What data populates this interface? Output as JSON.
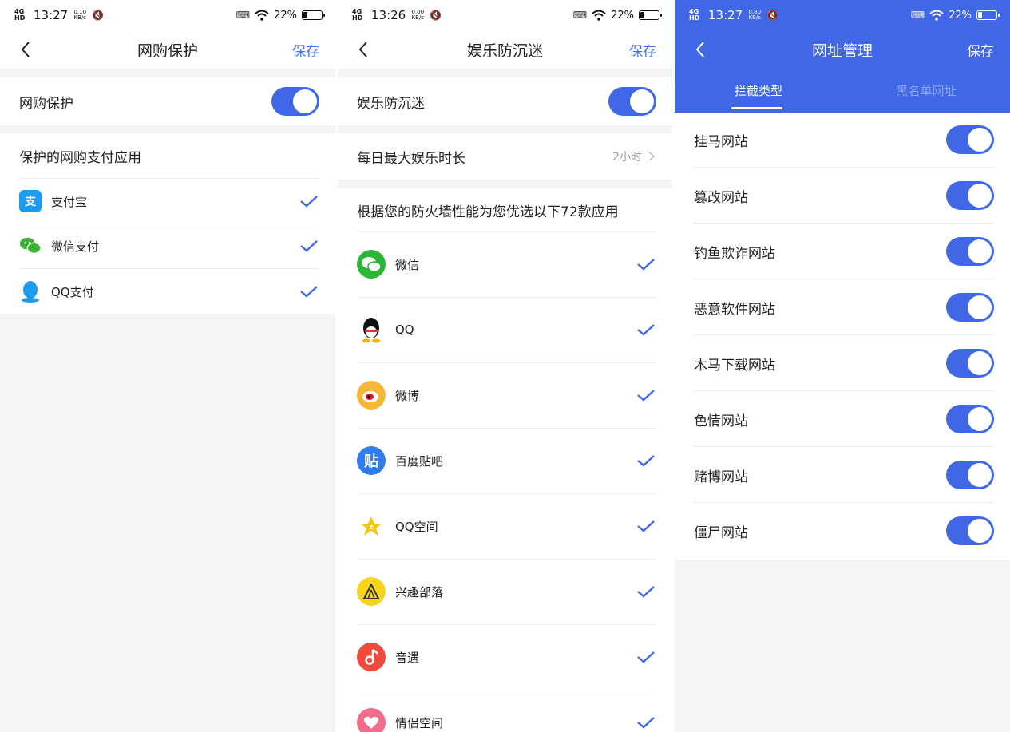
{
  "screens": [
    {
      "status": {
        "network": "4G HD",
        "time": "13:27",
        "speed": "0.10 KB/s",
        "battery": "22%",
        "battery_level": 0.22
      },
      "title": "网购保护",
      "save_label": "保存",
      "main_toggle_label": "网购保护",
      "main_toggle_on": true,
      "section_header": "保护的网购支付应用",
      "apps": [
        {
          "label": "支付宝",
          "icon": "alipay-icon",
          "checked": true
        },
        {
          "label": "微信支付",
          "icon": "wechat-pay-icon",
          "checked": true
        },
        {
          "label": "QQ支付",
          "icon": "qq-pay-icon",
          "checked": true
        }
      ]
    },
    {
      "status": {
        "network": "4G HD",
        "time": "13:26",
        "speed": "0.00 KB/s",
        "battery": "22%",
        "battery_level": 0.22
      },
      "title": "娱乐防沉迷",
      "save_label": "保存",
      "main_toggle_label": "娱乐防沉迷",
      "main_toggle_on": true,
      "daily_limit_label": "每日最大娱乐时长",
      "daily_limit_value": "2小时",
      "section_header": "根据您的防火墙性能为您优选以下72款应用",
      "apps": [
        {
          "label": "微信",
          "icon": "wechat-icon",
          "checked": true
        },
        {
          "label": "QQ",
          "icon": "qq-icon",
          "checked": true
        },
        {
          "label": "微博",
          "icon": "weibo-icon",
          "checked": true
        },
        {
          "label": "百度贴吧",
          "icon": "tieba-icon",
          "checked": true
        },
        {
          "label": "QQ空间",
          "icon": "qzone-icon",
          "checked": true
        },
        {
          "label": "兴趣部落",
          "icon": "buluo-icon",
          "checked": true
        },
        {
          "label": "音遇",
          "icon": "yinyu-icon",
          "checked": true
        },
        {
          "label": "情侣空间",
          "icon": "couple-space-icon",
          "checked": true
        }
      ]
    },
    {
      "status": {
        "network": "4G HD",
        "time": "13:27",
        "speed": "0.80 KB/s",
        "battery": "22%",
        "battery_level": 0.22
      },
      "title": "网址管理",
      "save_label": "保存",
      "tabs": [
        {
          "label": "拦截类型",
          "active": true
        },
        {
          "label": "黑名单网址",
          "active": false
        }
      ],
      "items": [
        {
          "label": "挂马网站",
          "on": true
        },
        {
          "label": "篡改网站",
          "on": true
        },
        {
          "label": "钓鱼欺诈网站",
          "on": true
        },
        {
          "label": "恶意软件网站",
          "on": true
        },
        {
          "label": "木马下载网站",
          "on": true
        },
        {
          "label": "色情网站",
          "on": true
        },
        {
          "label": "赌博网站",
          "on": true
        },
        {
          "label": "僵尸网站",
          "on": true
        }
      ]
    }
  ],
  "colors": {
    "accent": "#3f67e6",
    "link": "#3e74e8",
    "background": "#f4f4f4"
  }
}
